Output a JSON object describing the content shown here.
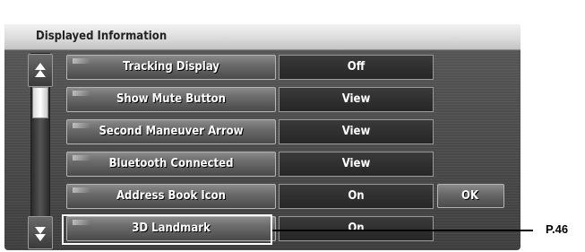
{
  "screen": {
    "title": "Displayed Information"
  },
  "rows": [
    {
      "label": "Tracking Display",
      "value": "Off"
    },
    {
      "label": "Show Mute Button",
      "value": "View"
    },
    {
      "label": "Second Maneuver Arrow",
      "value": "View"
    },
    {
      "label": "Bluetooth Connected",
      "value": "View"
    },
    {
      "label": "Address Book Icon",
      "value": "On"
    },
    {
      "label": "3D Landmark",
      "value": "On"
    }
  ],
  "buttons": {
    "ok_label": "OK"
  },
  "icons": {
    "scroll_up": "scroll-up-icon",
    "scroll_down": "scroll-down-icon"
  },
  "annotation": {
    "page_reference": "P.46"
  },
  "colors": {
    "screen_background": "#4a4a4a",
    "title_bar": "#dcdcdc",
    "highlight": "#ffffff"
  }
}
